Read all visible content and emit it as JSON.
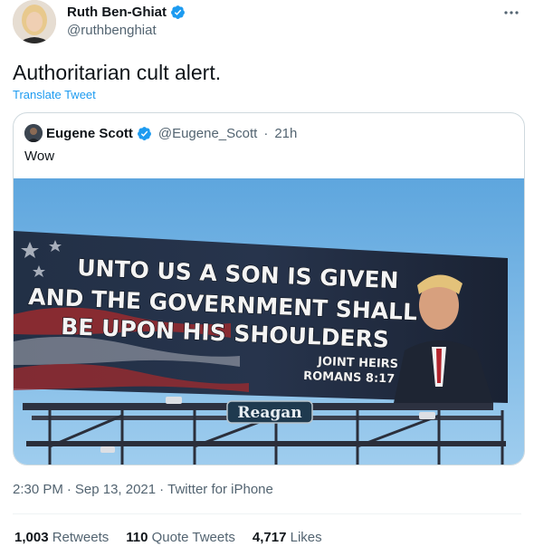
{
  "author": {
    "display_name": "Ruth Ben-Ghiat",
    "handle": "@ruthbenghiat"
  },
  "tweet": {
    "text": "Authoritarian cult alert.",
    "translate_label": "Translate Tweet"
  },
  "quoted": {
    "display_name": "Eugene Scott",
    "handle": "@Eugene_Scott",
    "separator": "·",
    "age": "21h",
    "text": "Wow",
    "billboard": {
      "line1": "UNTO US A SON IS GIVEN",
      "line2": "AND THE GOVERNMENT SHALL",
      "line3": "BE UPON HIS SHOULDERS",
      "ref1": "JOINT HEIRS",
      "ref2": "ROMANS 8:17",
      "brand": "Reagan"
    }
  },
  "meta": {
    "time": "2:30 PM",
    "sep1": "·",
    "date": "Sep 13, 2021",
    "sep2": "·",
    "source": "Twitter for iPhone"
  },
  "stats": {
    "retweets_count": "1,003",
    "retweets_label": "Retweets",
    "quotes_count": "110",
    "quotes_label": "Quote Tweets",
    "likes_count": "4,717",
    "likes_label": "Likes"
  },
  "colors": {
    "accent": "#1d9bf0",
    "secondary_text": "#536471",
    "border": "#cfd9de"
  },
  "icons": {
    "verified": "verified-badge-icon",
    "more": "more-options-icon"
  }
}
